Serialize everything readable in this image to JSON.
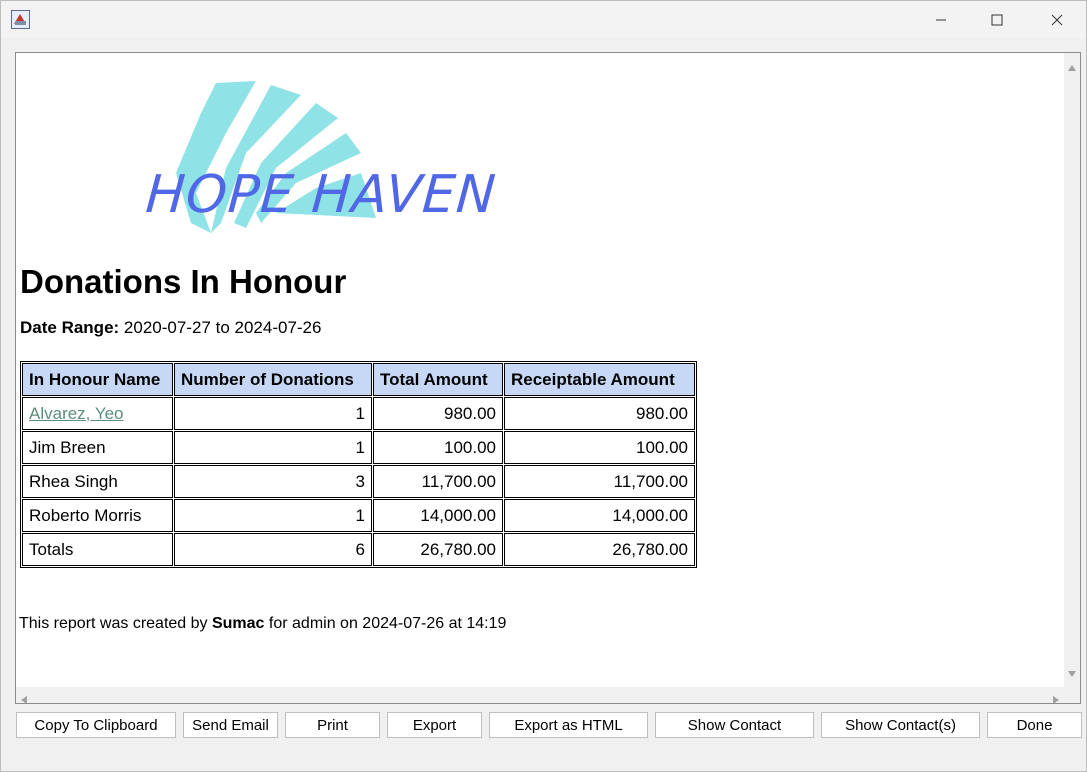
{
  "logo": {
    "text": "HOPE HAVEN"
  },
  "report": {
    "title": "Donations In Honour",
    "date_range_label": "Date Range:",
    "date_range_value": "2020-07-27 to 2024-07-26"
  },
  "table": {
    "headers": [
      "In Honour Name",
      "Number of Donations",
      "Total Amount",
      "Receiptable Amount"
    ],
    "rows": [
      [
        "Alvarez, Yeo",
        "1",
        "980.00",
        "980.00"
      ],
      [
        "Jim Breen",
        "1",
        "100.00",
        "100.00"
      ],
      [
        "Rhea Singh",
        "3",
        "11,700.00",
        "11,700.00"
      ],
      [
        "Roberto Morris",
        "1",
        "14,000.00",
        "14,000.00"
      ],
      [
        "Totals",
        "6",
        "26,780.00",
        "26,780.00"
      ]
    ]
  },
  "footer": {
    "prefix": "This report was created by",
    "app": "Sumac",
    "suffix": "for admin on 2024-07-26 at 14:19"
  },
  "buttons": {
    "copy": "Copy To Clipboard",
    "send_email": "Send Email",
    "print": "Print",
    "export": "Export",
    "export_html": "Export as HTML",
    "show_contact": "Show Contact",
    "show_contacts": "Show Contact(s)",
    "done": "Done"
  },
  "colors": {
    "header_bg": "#c7d8f7",
    "link": "#5a8f7a",
    "logo_text": "#5068e6",
    "logo_shape": "#8fe3e6"
  },
  "icons": [
    "app-icon",
    "minimize-icon",
    "maximize-icon",
    "close-icon",
    "scroll-up-icon",
    "scroll-down-icon",
    "scroll-left-icon",
    "scroll-right-icon"
  ]
}
